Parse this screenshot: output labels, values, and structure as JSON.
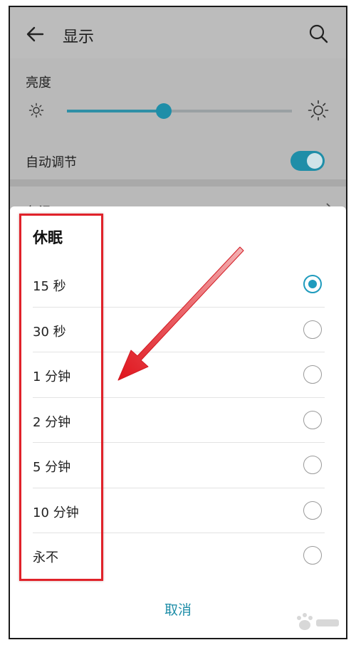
{
  "header": {
    "title": "显示",
    "back_icon": "back-arrow-icon",
    "search_icon": "search-icon"
  },
  "brightness": {
    "label": "亮度",
    "level_fraction": 0.43,
    "auto_label": "自动调节",
    "auto_enabled": true
  },
  "color_temp": {
    "label": "色温"
  },
  "sleep_dialog": {
    "title": "休眠",
    "options": [
      {
        "label": "15 秒",
        "selected": true
      },
      {
        "label": "30 秒",
        "selected": false
      },
      {
        "label": "1 分钟",
        "selected": false
      },
      {
        "label": "2 分钟",
        "selected": false
      },
      {
        "label": "5 分钟",
        "selected": false
      },
      {
        "label": "10 分钟",
        "selected": false
      },
      {
        "label": "永不",
        "selected": false
      }
    ],
    "cancel_label": "取消"
  },
  "colors": {
    "accent": "#1f8ea8",
    "highlight": "#e0222a"
  }
}
